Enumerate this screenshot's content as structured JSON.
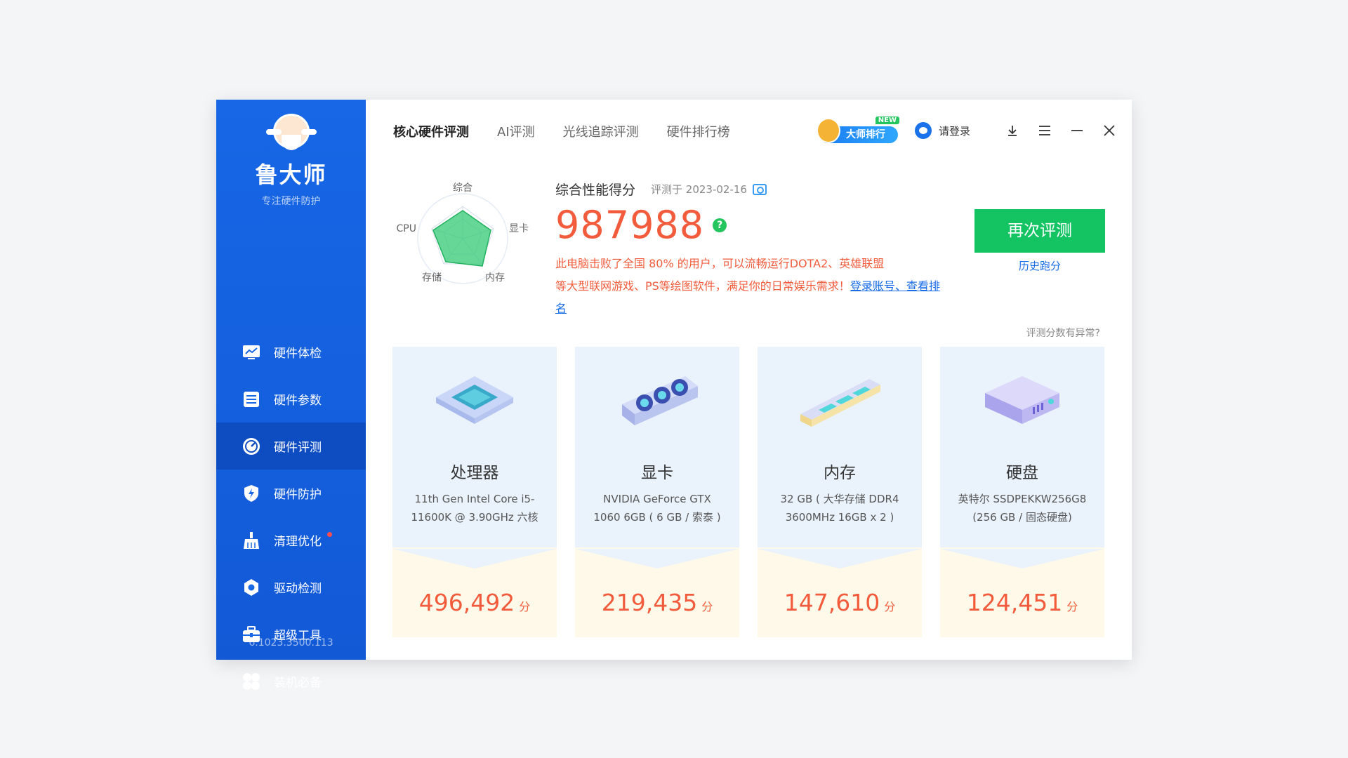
{
  "sidebar": {
    "app_name": "鲁大师",
    "tagline": "专注硬件防护",
    "items": [
      {
        "label": "硬件体检",
        "icon": "monitor-chart-icon"
      },
      {
        "label": "硬件参数",
        "icon": "list-settings-icon"
      },
      {
        "label": "硬件评测",
        "icon": "speedometer-icon",
        "active": true
      },
      {
        "label": "硬件防护",
        "icon": "shield-bolt-icon"
      },
      {
        "label": "清理优化",
        "icon": "broom-icon",
        "badge": "red-dot"
      },
      {
        "label": "驱动检测",
        "icon": "gear-icon"
      },
      {
        "label": "超级工具",
        "icon": "toolbox-icon"
      },
      {
        "label": "装机必备",
        "icon": "apps-grid-icon"
      }
    ],
    "version": "6.1023.3500.113"
  },
  "tabs": [
    {
      "label": "核心硬件评测",
      "active": true
    },
    {
      "label": "AI评测"
    },
    {
      "label": "光线追踪评测"
    },
    {
      "label": "硬件排行榜"
    }
  ],
  "header": {
    "rank_label": "大师排行",
    "new_tag": "NEW",
    "login_label": "请登录"
  },
  "radar": {
    "labels": {
      "top": "综合",
      "left": "CPU",
      "right": "显卡",
      "bottom_left": "存储",
      "bottom_right": "内存"
    }
  },
  "score": {
    "title": "综合性能得分",
    "date": "评测于 2023-02-16",
    "value": "987988",
    "desc_line1": "此电脑击败了全国 80% 的用户，可以流畅运行DOTA2、英雄联盟",
    "desc_line2": "等大型联网游戏、PS等绘图软件，满足你的日常娱乐需求！",
    "login_link": "登录账号、查看排名",
    "help": "?"
  },
  "actions": {
    "retest": "再次评测",
    "history": "历史跑分",
    "anomaly": "评测分数有异常?"
  },
  "cards": [
    {
      "title": "处理器",
      "desc": "11th Gen Intel Core i5-11600K @ 3.90GHz 六核",
      "score": "496,492",
      "unit": "分"
    },
    {
      "title": "显卡",
      "desc": "NVIDIA GeForce GTX 1060 6GB ( 6 GB / 索泰 )",
      "score": "219,435",
      "unit": "分"
    },
    {
      "title": "内存",
      "desc": "32 GB ( 大华存储 DDR4 3600MHz 16GB x 2 )",
      "score": "147,610",
      "unit": "分"
    },
    {
      "title": "硬盘",
      "desc": "英特尔 SSDPEKKW256G8 (256 GB / 固态硬盘)",
      "score": "124,451",
      "unit": "分"
    }
  ],
  "colors": {
    "sidebar_bg": "#1767e6",
    "sidebar_active": "#0e4cc2",
    "score_red": "#f25c3c",
    "retest_green": "#14c463",
    "link_blue": "#1a6de8"
  }
}
